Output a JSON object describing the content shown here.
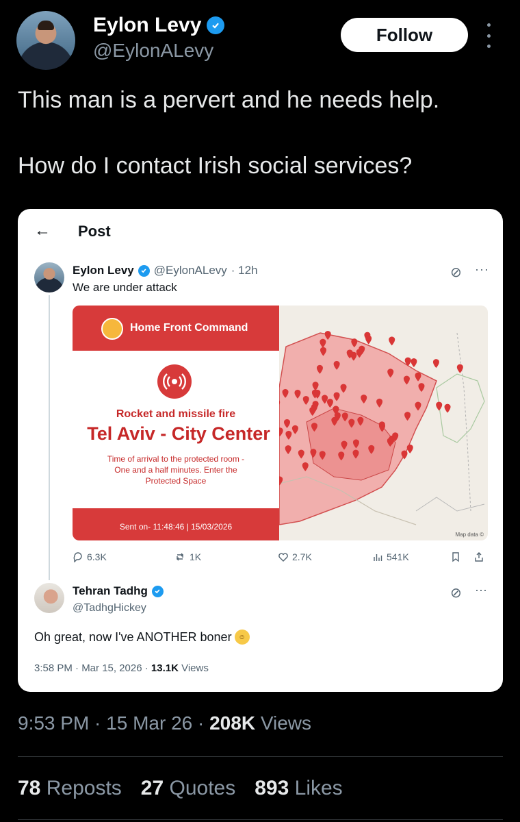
{
  "author": {
    "name": "Eylon Levy",
    "handle": "@EylonALevy",
    "follow_label": "Follow"
  },
  "tweet": {
    "line1": "This man is a pervert and he needs help.",
    "line2": "How do I contact Irish social services?"
  },
  "embedded": {
    "header_title": "Post",
    "quoted": {
      "name": "Eylon Levy",
      "handle": "@EylonALevy",
      "time": "· 12h",
      "text": "We are under attack"
    },
    "alert": {
      "org": "Home Front Command",
      "title": "Rocket and missile fire",
      "city": "Tel Aviv - City Center",
      "body": "Time of arrival to the protected room - One and a half minutes. Enter the Protected Space",
      "sent": "Sent on- 11:48:46 | 15/03/2026"
    },
    "map": {
      "credit": "Map data ©"
    },
    "actions": {
      "replies": "6.3K",
      "reposts": "1K",
      "likes": "2.7K",
      "views": "541K"
    },
    "reply": {
      "name": "Tehran Tadhg",
      "handle": "@TadhgHickey",
      "text": "Oh great, now I've ANOTHER boner",
      "time": "3:58 PM · Mar 15, 2026 · ",
      "views_count": "13.1K",
      "views_label": " Views"
    }
  },
  "footer": {
    "timestamp": "9:53 PM · 15 Mar 26 · ",
    "views_count": "208K",
    "views_label": " Views",
    "reposts_count": "78",
    "reposts_label": "Reposts",
    "quotes_count": "27",
    "quotes_label": "Quotes",
    "likes_count": "893",
    "likes_label": "Likes"
  },
  "colors": {
    "verified": "#1d9bf0",
    "alert_red": "#d73a3a",
    "map_marker": "#d93636"
  }
}
